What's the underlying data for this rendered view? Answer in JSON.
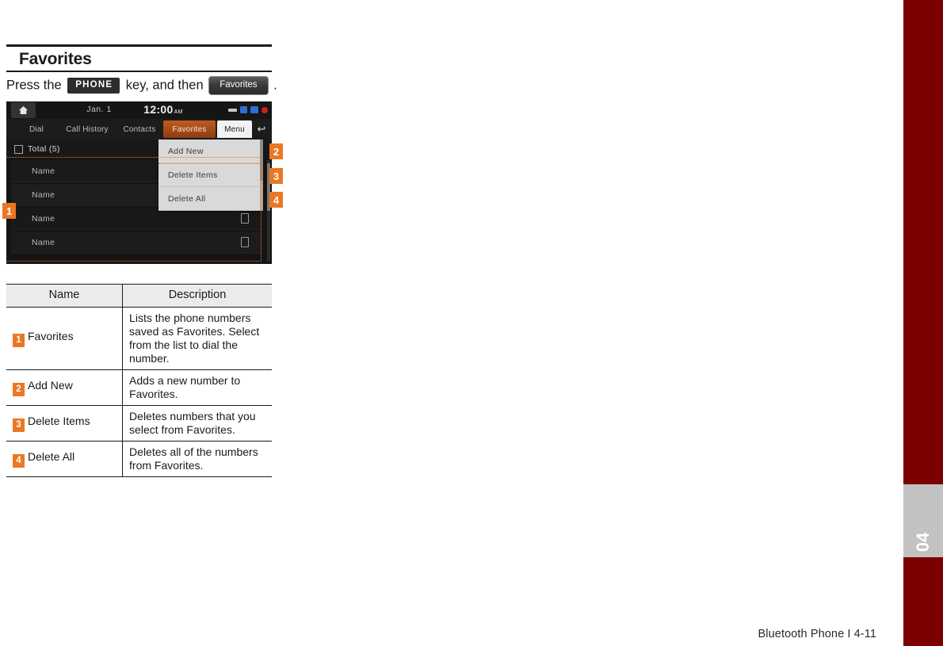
{
  "colors": {
    "accent_orange": "#ec7722",
    "spine_red": "#7d0000",
    "spine_tab_gray": "#c2c2c2",
    "table_header_gray": "#ebebeb",
    "rule_black": "#1a1a1a"
  },
  "heading": {
    "title": "Favorites"
  },
  "instruction": {
    "prefix": "Press the",
    "key_label": "PHONE",
    "middle": "key, and then",
    "button_label": "Favorites",
    "suffix": "."
  },
  "device": {
    "status_bar": {
      "home_icon": "home-icon",
      "date": "Jan.  1",
      "time": "12:00",
      "ampm": "AM",
      "icons": [
        "media-bar-icon",
        "bluetooth-icon",
        "signal-icon",
        "record-icon"
      ]
    },
    "tabs": [
      {
        "label": "Dial",
        "state": "inactive"
      },
      {
        "label": "Call History",
        "state": "inactive"
      },
      {
        "label": "Contacts",
        "state": "inactive"
      },
      {
        "label": "Favorites",
        "state": "active"
      },
      {
        "label": "Menu",
        "state": "open"
      }
    ],
    "back_icon": "back-arrow-icon",
    "total_row": {
      "icon": "list-icon",
      "label": "Total (5)"
    },
    "list_rows": [
      {
        "name": "Name",
        "has_icon": false
      },
      {
        "name": "Name",
        "has_icon": false
      },
      {
        "name": "Name",
        "has_icon": true
      },
      {
        "name": "Name",
        "has_icon": true
      }
    ],
    "dropdown_items": [
      {
        "label": "Add New"
      },
      {
        "label": "Delete Items"
      },
      {
        "label": "Delete All"
      }
    ]
  },
  "markers": {
    "m1": "1",
    "m2": "2",
    "m3": "3",
    "m4": "4"
  },
  "table": {
    "headers": [
      "Name",
      "Description"
    ],
    "rows": [
      {
        "badge": "1",
        "name": "Favorites",
        "description": "Lists the phone numbers saved as Favorites. Select from the list to dial the number."
      },
      {
        "badge": "2",
        "name": "Add New",
        "description": "Adds a new number to Favorites."
      },
      {
        "badge": "3",
        "name": "Delete Items",
        "description": "Deletes numbers that you select from Favorites."
      },
      {
        "badge": "4",
        "name": "Delete All",
        "description": "Deletes all of the numbers from Favorites."
      }
    ]
  },
  "spine": {
    "chapter_number": "04"
  },
  "footer": {
    "text": "Bluetooth Phone I 4-11"
  }
}
